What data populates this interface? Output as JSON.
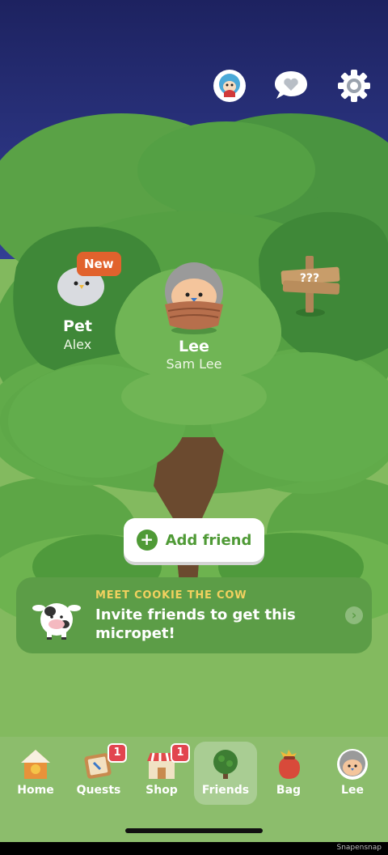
{
  "top_icons": [
    "avatar-heart-icon",
    "chat-heart-icon",
    "gear-icon"
  ],
  "friends": [
    {
      "name": "Pet",
      "subtitle": "Alex",
      "badge": "New"
    },
    {
      "name": "Lee",
      "subtitle": "Sam Lee"
    }
  ],
  "signpost": {
    "text": "???"
  },
  "add_friend": {
    "label": "Add friend"
  },
  "promo": {
    "kicker": "MEET COOKIE THE COW",
    "title": "Invite friends to get this micropet!"
  },
  "tabs": [
    {
      "label": "Home",
      "icon": "birdhouse-icon"
    },
    {
      "label": "Quests",
      "icon": "quests-icon",
      "count": "1"
    },
    {
      "label": "Shop",
      "icon": "shop-icon",
      "count": "1"
    },
    {
      "label": "Friends",
      "icon": "tree-icon",
      "selected": true
    },
    {
      "label": "Bag",
      "icon": "bag-icon"
    },
    {
      "label": "Lee",
      "icon": "avatar-icon"
    }
  ],
  "footer": {
    "watermark": "Snapensnap"
  },
  "colors": {
    "sky_top": "#1e2363",
    "sky_bottom": "#303b8f",
    "leaf_dark": "#3f8a38",
    "leaf_mid": "#5da646",
    "leaf_light": "#6fb64f",
    "trunk": "#6b4a2f",
    "accent_green": "#4f9a36",
    "badge_orange": "#e1622d",
    "kicker_yellow": "#f2d15f"
  }
}
